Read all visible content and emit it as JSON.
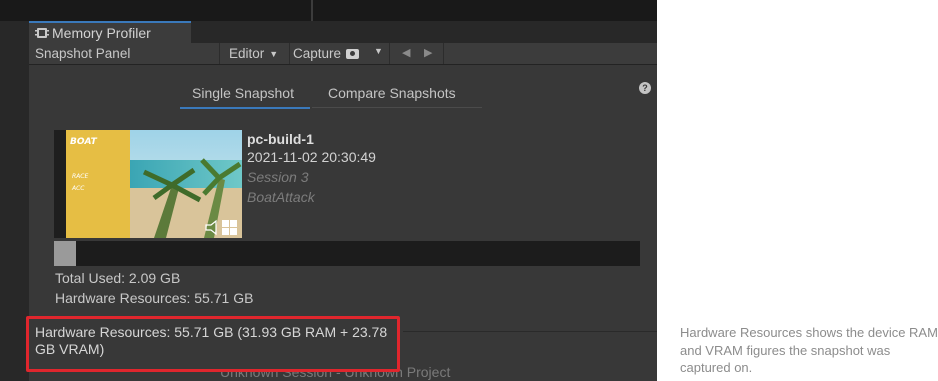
{
  "window": {
    "tab_title": "Memory Profiler",
    "panel_title": "Snapshot Panel"
  },
  "toolbar": {
    "editor_label": "Editor",
    "capture_label": "Capture",
    "icons": [
      "camera-icon",
      "arrow-left-icon",
      "arrow-right-icon",
      "chevron-down-icon"
    ]
  },
  "mode_tabs": {
    "single": "Single Snapshot",
    "compare": "Compare Snapshots",
    "selected": "Single Snapshot"
  },
  "snapshot": {
    "name": "pc-build-1",
    "datetime": "2021-11-02 20:30:49",
    "session": "Session 3",
    "project": "BoatAttack",
    "platform_icon": "windows-icon",
    "thumbnail_text": [
      "BOAT",
      "RACE",
      "ACC"
    ]
  },
  "memory_bar": {
    "used_fraction": 0.037
  },
  "stats": {
    "total_used": "Total Used: 2.09 GB",
    "hardware_resources": "Hardware Resources: 55.71 GB"
  },
  "tooltip": {
    "text": "Hardware Resources: 55.71 GB (31.93 GB RAM + 23.78 GB VRAM)"
  },
  "footer": {
    "text": "Unknown Session - Unknown Project"
  },
  "caption": {
    "text": "Hardware Resources shows the device RAM and VRAM figures the snapshot was captured on."
  },
  "colors": {
    "accent": "#3a79bb",
    "highlight": "#e0262d"
  }
}
